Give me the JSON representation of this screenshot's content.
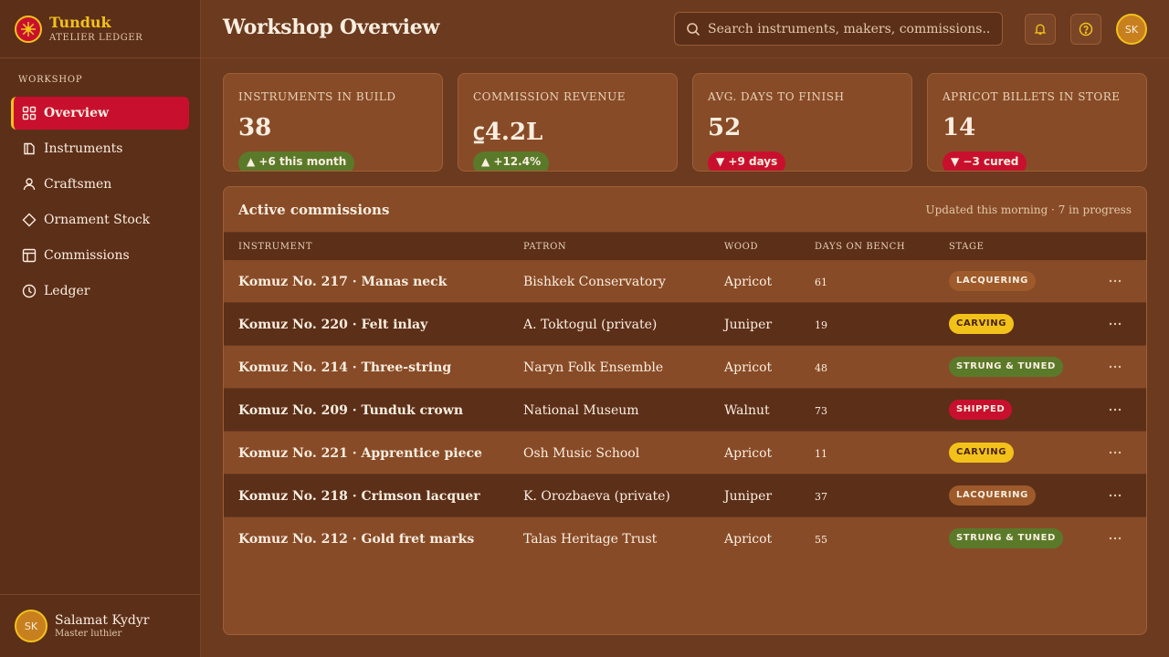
{
  "brand": {
    "name": "Tunduk",
    "subtitle": "ATELIER LEDGER"
  },
  "sidebar": {
    "section": "WORKSHOP",
    "items": [
      {
        "label": "Overview",
        "icon": "grid-icon",
        "active": true
      },
      {
        "label": "Instruments",
        "icon": "book-icon"
      },
      {
        "label": "Craftsmen",
        "icon": "person-icon"
      },
      {
        "label": "Ornament Stock",
        "icon": "diamond-icon"
      },
      {
        "label": "Commissions",
        "icon": "layout-icon"
      },
      {
        "label": "Ledger",
        "icon": "clock-icon"
      }
    ],
    "user": {
      "initials": "SK",
      "name": "Salamat Kydyr",
      "role": "Master luthier"
    }
  },
  "header": {
    "title": "Workshop Overview",
    "search_placeholder": "Search instruments, makers, commissions...",
    "avatar_initials": "SK"
  },
  "stats": [
    {
      "label": "INSTRUMENTS IN BUILD",
      "value": "38",
      "delta": "▲ +6 this month",
      "trend": "up"
    },
    {
      "label": "COMMISSION REVENUE",
      "value": "⃀4.2L",
      "delta": "▲ +12.4%",
      "trend": "up"
    },
    {
      "label": "AVG. DAYS TO FINISH",
      "value": "52",
      "delta": "▼ +9 days",
      "trend": "down"
    },
    {
      "label": "APRICOT BILLETS IN STORE",
      "value": "14",
      "delta": "▼ −3 cured",
      "trend": "down"
    }
  ],
  "commissions": {
    "title": "Active commissions",
    "meta": "Updated this morning · 7 in progress",
    "columns": [
      "INSTRUMENT",
      "PATRON",
      "WOOD",
      "DAYS ON BENCH",
      "STAGE"
    ],
    "rows": [
      {
        "instrument": "Komuz No. 217 · Manas neck",
        "patron": "Bishkek Conservatory",
        "wood": "Apricot",
        "days": "61",
        "stage": "LACQUERING"
      },
      {
        "instrument": "Komuz No. 220 · Felt inlay",
        "patron": "A. Toktogul (private)",
        "wood": "Juniper",
        "days": "19",
        "stage": "CARVING"
      },
      {
        "instrument": "Komuz No. 214 · Three-string",
        "patron": "Naryn Folk Ensemble",
        "wood": "Apricot",
        "days": "48",
        "stage": "STRUNG & TUNED"
      },
      {
        "instrument": "Komuz No. 209 · Tunduk crown",
        "patron": "National Museum",
        "wood": "Walnut",
        "days": "73",
        "stage": "SHIPPED"
      },
      {
        "instrument": "Komuz No. 221 · Apprentice piece",
        "patron": "Osh Music School",
        "wood": "Apricot",
        "days": "11",
        "stage": "CARVING"
      },
      {
        "instrument": "Komuz No. 218 · Crimson lacquer",
        "patron": "K. Orozbaeva (private)",
        "wood": "Juniper",
        "days": "37",
        "stage": "LACQUERING"
      },
      {
        "instrument": "Komuz No. 212 · Gold fret marks",
        "patron": "Talas Heritage Trust",
        "wood": "Apricot",
        "days": "55",
        "stage": "STRUNG & TUNED"
      }
    ]
  },
  "colors": {
    "background": "#6b3a1f",
    "sidebar": "#5c2f19",
    "accent_red": "#c8102e",
    "accent_gold": "#f2c21a",
    "positive": "#5a7a2a"
  }
}
